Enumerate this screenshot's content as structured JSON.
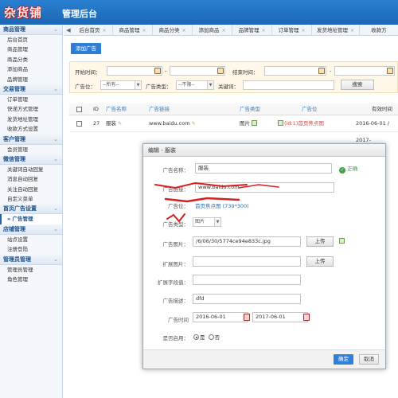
{
  "app": {
    "logo_text": "杂货铺",
    "title": "管理后台"
  },
  "sidebar": {
    "sections": [
      {
        "title": "商品管理",
        "items": [
          "后台首页",
          "商品管理",
          "商品分类",
          "添加商品",
          "品牌管理"
        ]
      },
      {
        "title": "交易管理",
        "items": [
          "订单管理",
          "快递方式管理",
          "发货地址管理",
          "收款方式设置"
        ]
      },
      {
        "title": "客户管理",
        "items": [
          "会员管理"
        ]
      },
      {
        "title": "微信管理",
        "items": [
          "关键词自动回复",
          "消息自动回复",
          "关注自动回复",
          "自定义菜单"
        ]
      },
      {
        "title": "首页广告设置",
        "items": [
          "» 广告管理"
        ]
      },
      {
        "title": "店铺管理",
        "items": [
          "站点设置",
          "注册登陆"
        ]
      },
      {
        "title": "管理员管理",
        "items": [
          "管理员管理",
          "角色管理"
        ]
      }
    ]
  },
  "tabs": [
    "后台首页",
    "商品管理",
    "商品分类",
    "添加商品",
    "品牌管理",
    "订单管理",
    "发货地址管理",
    "收款方"
  ],
  "toolbar": {
    "add_label": "添加广告"
  },
  "filter": {
    "start_label": "开始时间：",
    "dash": "-",
    "end_label": "结束时间：",
    "position_label": "广告位：",
    "position_value": "--所有--",
    "type_label": "广告类型：",
    "type_value": "--不限--",
    "keyword_label": "关键词：",
    "search_label": "搜索"
  },
  "table": {
    "headers": [
      "ID",
      "广告名称",
      "广告链接",
      "广告类型",
      "广告位",
      "有效时间"
    ],
    "rows": [
      {
        "id": "27",
        "name": "服装",
        "link": "www.baidu.com",
        "type": "图片",
        "position": "(id:1)首页焦点图",
        "time": "2016-06-01 / 2017-"
      }
    ]
  },
  "modal": {
    "title": "编辑 - 服装",
    "name_label": "广告名称：",
    "name_value": "服装",
    "name_status": "正确",
    "link_label": "广告链接：",
    "link_value": "www.baidu.com",
    "position_label": "广告位：",
    "position_link": "首页焦点图 (730*300)",
    "type_label": "广告类型：",
    "type_value": "图片",
    "image_label": "广告图片：",
    "image_value": "/6/06/30/5774ce94e833c.jpg",
    "upload_label": "上传",
    "ext_image_label": "扩展图片：",
    "ext_field_label": "扩展字段值：",
    "desc_label": "广告描述：",
    "desc_value": "dfd",
    "time_label": "广告时间",
    "start_date": "2016-06-01",
    "end_date": "2017-06-01",
    "enable_label": "是否启用：",
    "yes_label": "是",
    "no_label": "否",
    "confirm_label": "确定",
    "cancel_label": "取消"
  },
  "colors": {
    "header_blue": "#1b66b5",
    "accent_blue": "#2e7fd4",
    "filter_bg": "#fff8e8",
    "logo_red": "#c01818",
    "success_green": "#43a047"
  }
}
